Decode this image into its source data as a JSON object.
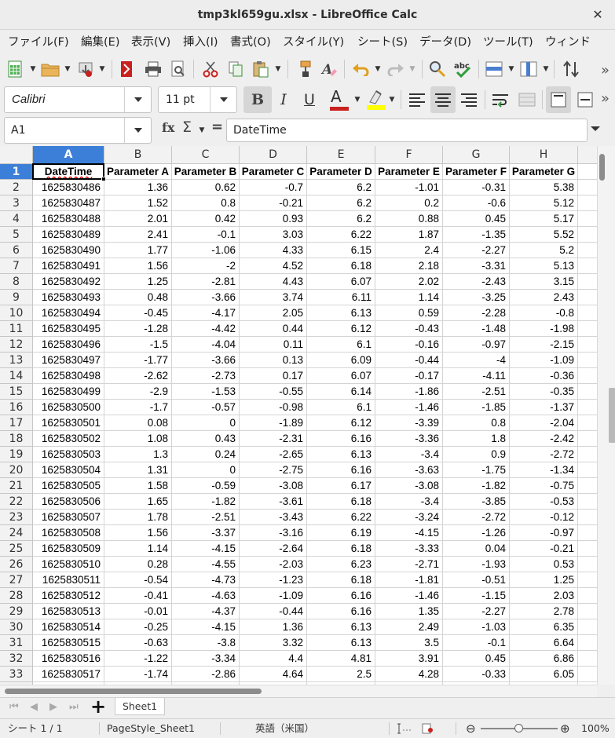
{
  "window": {
    "title": "tmp3kl659gu.xlsx - LibreOffice Calc",
    "close_glyph": "✕"
  },
  "menu": [
    "ファイル(F)",
    "編集(E)",
    "表示(V)",
    "挿入(I)",
    "書式(O)",
    "スタイル(Y)",
    "シート(S)",
    "データ(D)",
    "ツール(T)",
    "ウィンド"
  ],
  "toolbar": {
    "font_name": "Calibri",
    "font_size": "11 pt",
    "more_glyph": "»",
    "icons": [
      "new-document-icon",
      "open-folder-icon",
      "save-icon",
      "export-pdf-icon",
      "print-icon",
      "print-preview-icon",
      "cut-icon",
      "copy-icon",
      "paste-icon",
      "clone-formatting-icon",
      "clear-formatting-icon",
      "undo-icon",
      "redo-icon",
      "find-replace-icon",
      "spelling-icon",
      "row-icon",
      "column-icon",
      "sort-icon",
      "bold-icon",
      "italic-icon",
      "underline-icon",
      "font-color-icon",
      "highlight-icon",
      "align-left-icon",
      "align-center-icon",
      "align-right-icon",
      "wrap-text-icon",
      "merge-cells-icon",
      "align-top-icon",
      "align-center-vertical-icon"
    ],
    "bold_label": "B",
    "italic_label": "I",
    "underline_label": "U",
    "font_color_label": "A",
    "font_color": "#c9211e",
    "highlight_color": "#ffff00"
  },
  "formula_bar": {
    "name_box": "A1",
    "fx_label": "fx",
    "sigma_label": "Σ",
    "equals_label": "=",
    "content": "DateTime"
  },
  "sheet": {
    "columns": [
      "A",
      "B",
      "C",
      "D",
      "E",
      "F",
      "G",
      "H"
    ],
    "selected_column": "A",
    "selected_row": 1,
    "accent": "#3c7fd8",
    "header_row": [
      "DateTime",
      "Parameter A",
      "Parameter B",
      "Parameter C",
      "Parameter D",
      "Parameter E",
      "Parameter F",
      "Parameter G"
    ],
    "rows": [
      [
        "1625830486",
        "1.36",
        "0.62",
        "-0.7",
        "6.2",
        "-1.01",
        "-0.31",
        "5.38"
      ],
      [
        "1625830487",
        "1.52",
        "0.8",
        "-0.21",
        "6.2",
        "0.2",
        "-0.6",
        "5.12"
      ],
      [
        "1625830488",
        "2.01",
        "0.42",
        "0.93",
        "6.2",
        "0.88",
        "0.45",
        "5.17"
      ],
      [
        "1625830489",
        "2.41",
        "-0.1",
        "3.03",
        "6.22",
        "1.87",
        "-1.35",
        "5.52"
      ],
      [
        "1625830490",
        "1.77",
        "-1.06",
        "4.33",
        "6.15",
        "2.4",
        "-2.27",
        "5.2"
      ],
      [
        "1625830491",
        "1.56",
        "-2",
        "4.52",
        "6.18",
        "2.18",
        "-3.31",
        "5.13"
      ],
      [
        "1625830492",
        "1.25",
        "-2.81",
        "4.43",
        "6.07",
        "2.02",
        "-2.43",
        "3.15"
      ],
      [
        "1625830493",
        "0.48",
        "-3.66",
        "3.74",
        "6.11",
        "1.14",
        "-3.25",
        "2.43"
      ],
      [
        "1625830494",
        "-0.45",
        "-4.17",
        "2.05",
        "6.13",
        "0.59",
        "-2.28",
        "-0.8"
      ],
      [
        "1625830495",
        "-1.28",
        "-4.42",
        "0.44",
        "6.12",
        "-0.43",
        "-1.48",
        "-1.98"
      ],
      [
        "1625830496",
        "-1.5",
        "-4.04",
        "0.11",
        "6.1",
        "-0.16",
        "-0.97",
        "-2.15"
      ],
      [
        "1625830497",
        "-1.77",
        "-3.66",
        "0.13",
        "6.09",
        "-0.44",
        "-4",
        "-1.09"
      ],
      [
        "1625830498",
        "-2.62",
        "-2.73",
        "0.17",
        "6.07",
        "-0.17",
        "-4.11",
        "-0.36"
      ],
      [
        "1625830499",
        "-2.9",
        "-1.53",
        "-0.55",
        "6.14",
        "-1.86",
        "-2.51",
        "-0.35"
      ],
      [
        "1625830500",
        "-1.7",
        "-0.57",
        "-0.98",
        "6.1",
        "-1.46",
        "-1.85",
        "-1.37"
      ],
      [
        "1625830501",
        "0.08",
        "0",
        "-1.89",
        "6.12",
        "-3.39",
        "0.8",
        "-2.04"
      ],
      [
        "1625830502",
        "1.08",
        "0.43",
        "-2.31",
        "6.16",
        "-3.36",
        "1.8",
        "-2.42"
      ],
      [
        "1625830503",
        "1.3",
        "0.24",
        "-2.65",
        "6.13",
        "-3.4",
        "0.9",
        "-2.72"
      ],
      [
        "1625830504",
        "1.31",
        "0",
        "-2.75",
        "6.16",
        "-3.63",
        "-1.75",
        "-1.34"
      ],
      [
        "1625830505",
        "1.58",
        "-0.59",
        "-3.08",
        "6.17",
        "-3.08",
        "-1.82",
        "-0.75"
      ],
      [
        "1625830506",
        "1.65",
        "-1.82",
        "-3.61",
        "6.18",
        "-3.4",
        "-3.85",
        "-0.53"
      ],
      [
        "1625830507",
        "1.78",
        "-2.51",
        "-3.43",
        "6.22",
        "-3.24",
        "-2.72",
        "-0.12"
      ],
      [
        "1625830508",
        "1.56",
        "-3.37",
        "-3.16",
        "6.19",
        "-4.15",
        "-1.26",
        "-0.97"
      ],
      [
        "1625830509",
        "1.14",
        "-4.15",
        "-2.64",
        "6.18",
        "-3.33",
        "0.04",
        "-0.21"
      ],
      [
        "1625830510",
        "0.28",
        "-4.55",
        "-2.03",
        "6.23",
        "-2.71",
        "-1.93",
        "0.53"
      ],
      [
        "1625830511",
        "-0.54",
        "-4.73",
        "-1.23",
        "6.18",
        "-1.81",
        "-0.51",
        "1.25"
      ],
      [
        "1625830512",
        "-0.41",
        "-4.63",
        "-1.09",
        "6.16",
        "-1.46",
        "-1.15",
        "2.03"
      ],
      [
        "1625830513",
        "-0.01",
        "-4.37",
        "-0.44",
        "6.16",
        "1.35",
        "-2.27",
        "2.78"
      ],
      [
        "1625830514",
        "-0.25",
        "-4.15",
        "1.36",
        "6.13",
        "2.49",
        "-1.03",
        "6.35"
      ],
      [
        "1625830515",
        "-0.63",
        "-3.8",
        "3.32",
        "6.13",
        "3.5",
        "-0.1",
        "6.64"
      ],
      [
        "1625830516",
        "-1.22",
        "-3.34",
        "4.4",
        "4.81",
        "3.91",
        "0.45",
        "6.86"
      ],
      [
        "1625830517",
        "-1.74",
        "-2.86",
        "4.64",
        "2.5",
        "4.28",
        "-0.33",
        "6.05"
      ]
    ]
  },
  "sheet_tabs": {
    "add_label": "+",
    "tabs": [
      "Sheet1"
    ]
  },
  "status": {
    "sheet": "シート 1 / 1",
    "page_style": "PageStyle_Sheet1",
    "language": "英語（米国）",
    "zoom_minus": "⊖",
    "zoom_plus": "⊕",
    "zoom": "100%"
  }
}
